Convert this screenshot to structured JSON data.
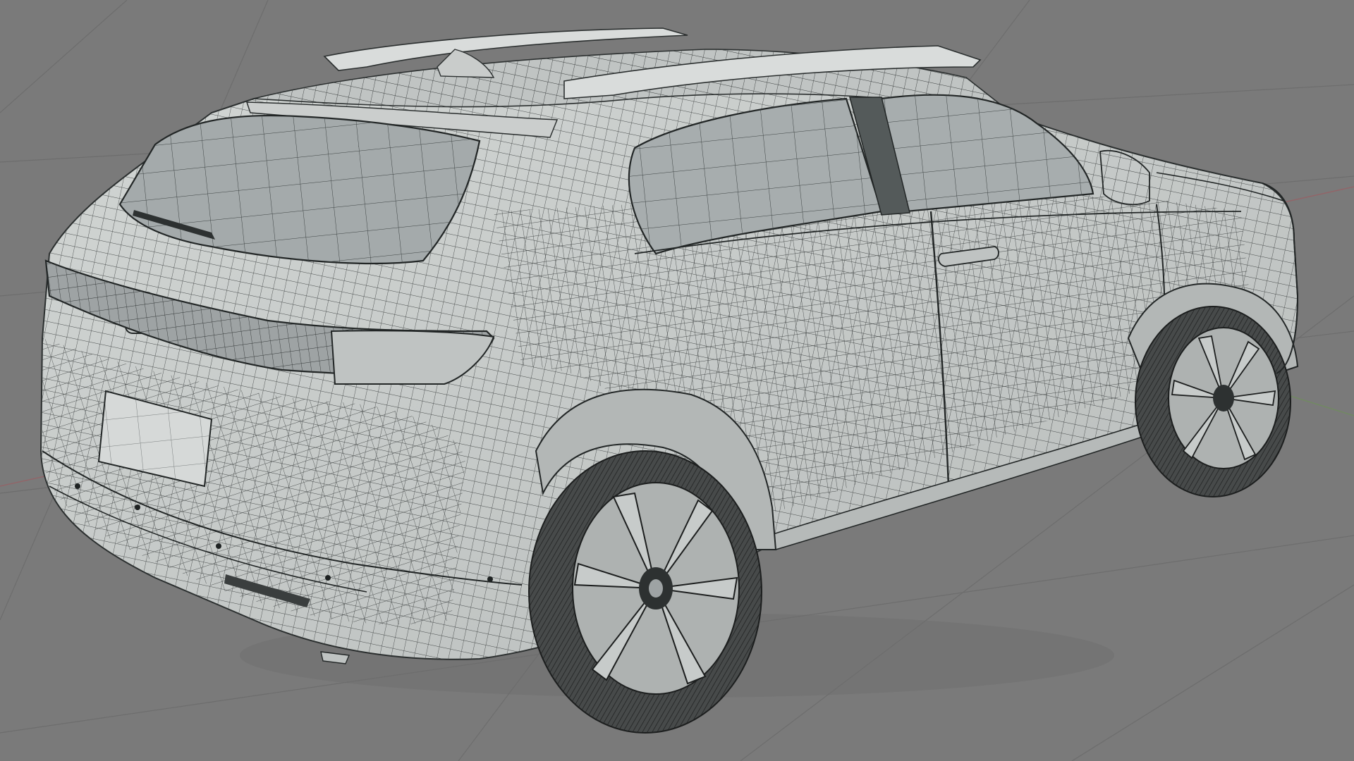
{
  "app": {
    "view": "3d-viewport",
    "shading": "wireframe-over-solid"
  },
  "viewport": {
    "background_color": "#7a7a7a",
    "grid_color": "#6e6e6e",
    "x_axis_color": "#b0505a",
    "y_axis_color": "#6e9a52"
  },
  "model": {
    "kind": "suv-wireframe",
    "body_color": "#c8ccca",
    "glass_color": "#9fa5a6",
    "wire_color": "#2e3232",
    "tire_color": "#4a4c4c"
  }
}
